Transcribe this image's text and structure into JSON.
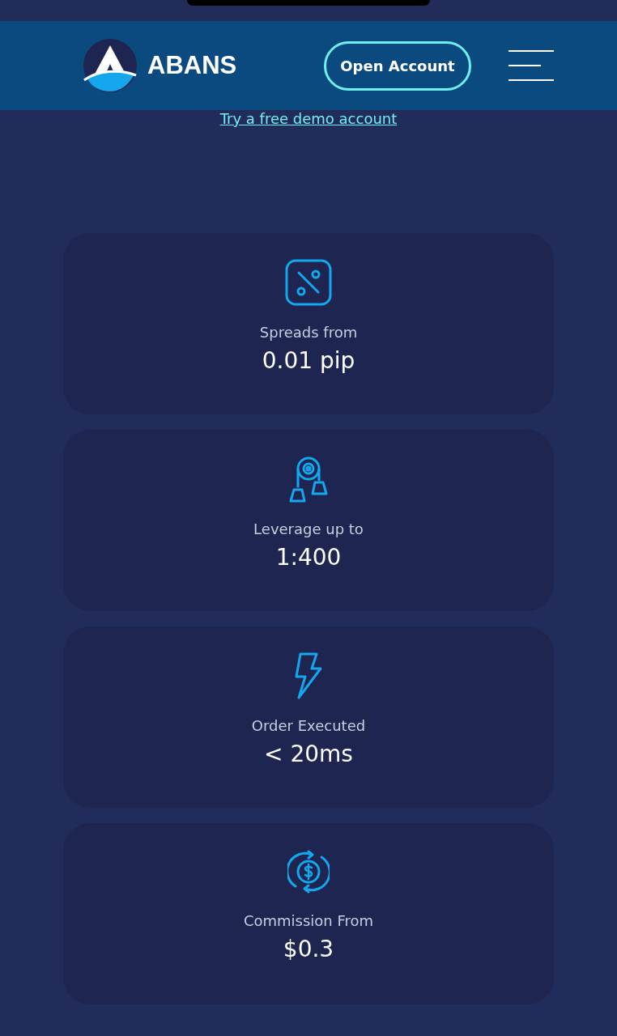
{
  "header": {
    "brand": "ABANS",
    "open_account": "Open Account"
  },
  "demo_link": "Try a free demo account",
  "features": [
    {
      "kind": "percent",
      "label": "Spreads from",
      "value": "0.01 pip"
    },
    {
      "kind": "pulley",
      "label": "Leverage up to",
      "value": "1:400"
    },
    {
      "kind": "bolt",
      "label": "Order Executed",
      "value": "< 20ms"
    },
    {
      "kind": "coin",
      "label": "Commission From",
      "value": "$0.3"
    }
  ]
}
